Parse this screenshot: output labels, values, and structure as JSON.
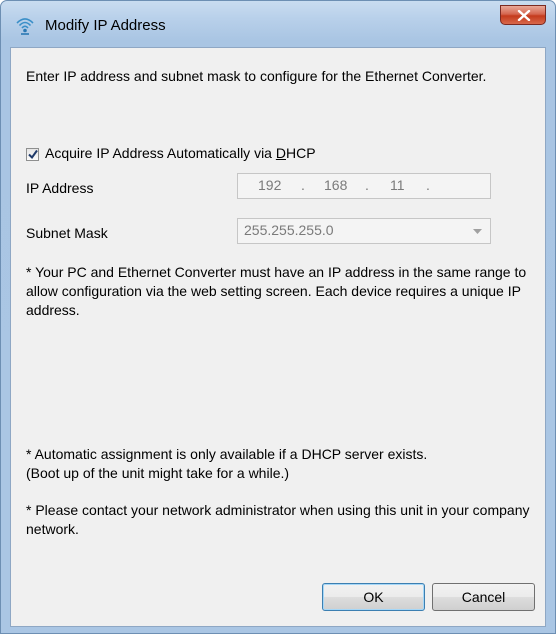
{
  "window": {
    "title": "Modify IP Address",
    "icon": "wifi-signal-icon"
  },
  "dialog": {
    "instruction": "Enter IP address and subnet mask to configure for the Ethernet Converter.",
    "dhcp": {
      "label_before": "Acquire IP Address Automatically via ",
      "label_mnemonic": "D",
      "label_after": "HCP",
      "checked": true
    },
    "ip_address": {
      "label": "IP Address",
      "octets": [
        "192",
        "168",
        "11",
        ""
      ],
      "separator": "."
    },
    "subnet_mask": {
      "label": "Subnet Mask",
      "value": "255.255.255.0"
    },
    "notes": [
      "* Your PC and Ethernet Converter must have an IP address in the same range to allow configuration via the web setting screen. Each device requires a unique IP address.",
      "* Automatic assignment is only available if a DHCP server exists.\n (Boot up of the unit might take for a while.)",
      "* Please contact your network administrator when using this unit in your company network."
    ]
  },
  "buttons": {
    "ok": "OK",
    "cancel": "Cancel"
  },
  "colors": {
    "title_bar": "#b8d0ea",
    "client_bg": "#f0f0f0",
    "close_button": "#c43b1c",
    "disabled_text": "#7a7a7a"
  }
}
